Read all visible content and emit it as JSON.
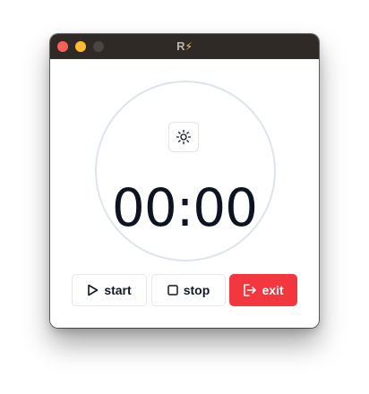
{
  "window": {
    "title_text": "R",
    "title_icon": "lightning-bolt-icon",
    "title_icon_glyph": "⚡"
  },
  "theme_toggle": {
    "icon": "sun-icon"
  },
  "timer": {
    "display": "00:00"
  },
  "controls": {
    "start_label": "start",
    "start_icon": "play-icon",
    "stop_label": "stop",
    "stop_icon": "stop-square-icon",
    "exit_label": "exit",
    "exit_icon": "exit-icon"
  },
  "colors": {
    "titlebar": "#2f2a26",
    "close": "#fe5f57",
    "minimize": "#febc2e",
    "zoom_inactive": "#4a4542",
    "exit_button": "#f2373f",
    "ring": "#dde4ea",
    "time_text": "#0d1320"
  }
}
